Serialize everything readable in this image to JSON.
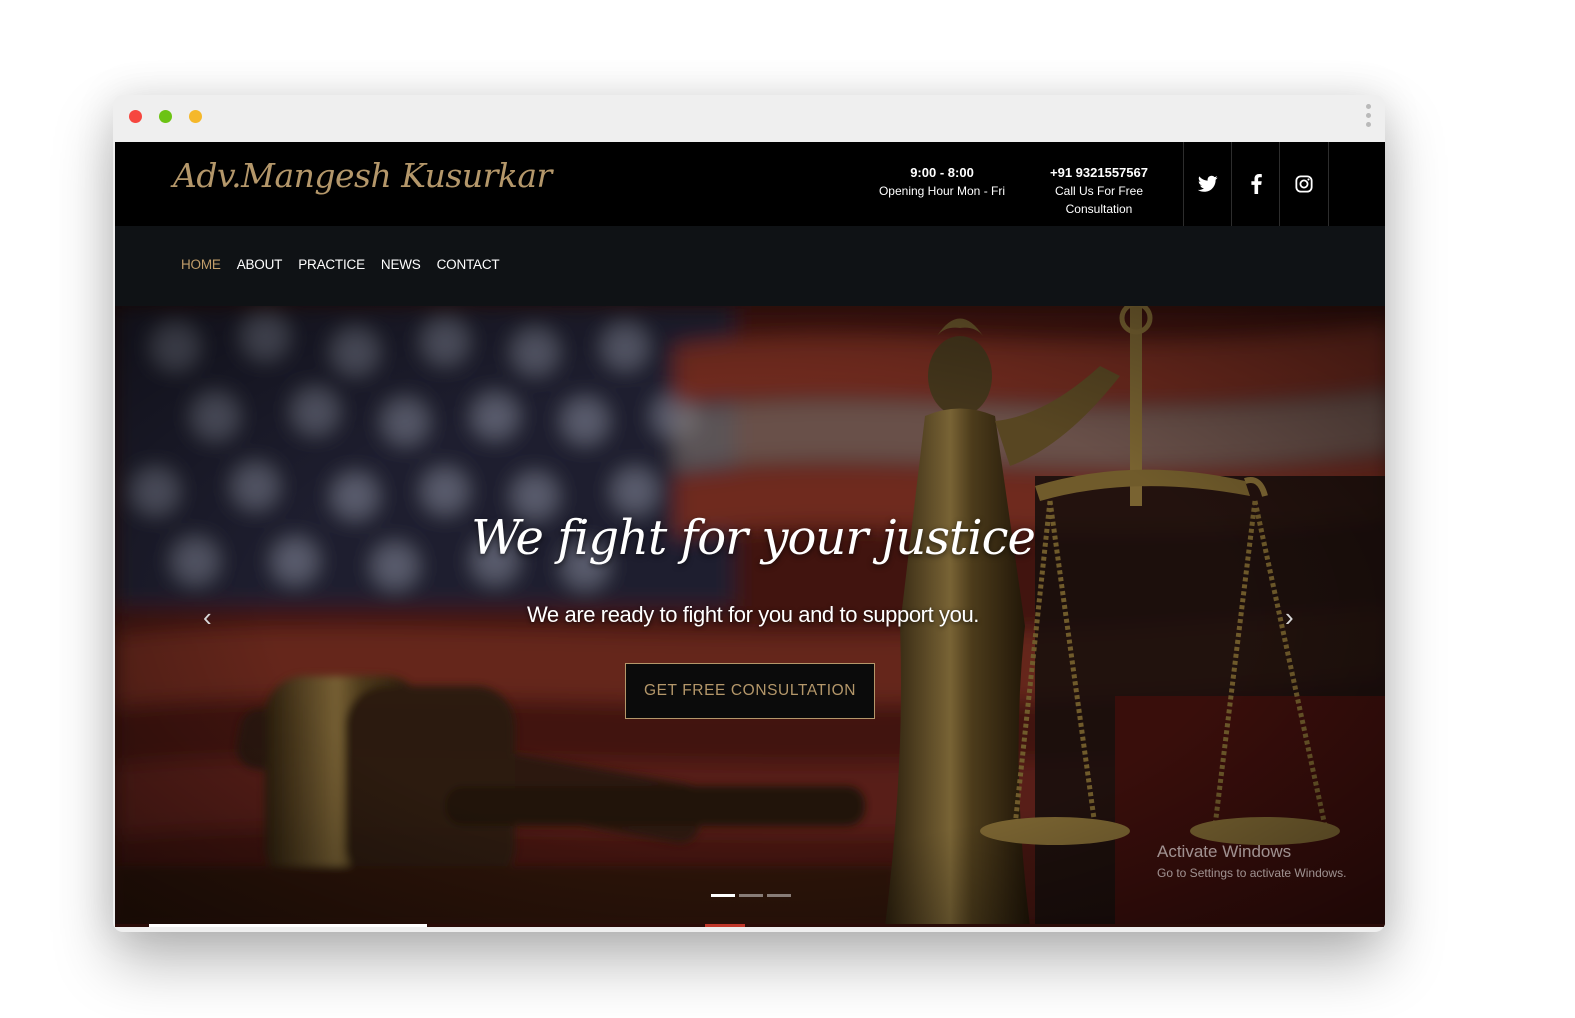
{
  "site": {
    "logo_text": "Adv.Mangesh Kusurkar"
  },
  "header": {
    "hours_time": "9:00 - 8:00",
    "hours_label": "Opening Hour Mon - Fri",
    "phone_number": "+91 9321557567",
    "phone_label": "Call Us For Free Consultation"
  },
  "social": [
    "twitter-icon",
    "facebook-icon",
    "instagram-icon"
  ],
  "nav": {
    "items": [
      {
        "label": "HOME",
        "active": true
      },
      {
        "label": "ABOUT"
      },
      {
        "label": "PRACTICE"
      },
      {
        "label": "NEWS"
      },
      {
        "label": "CONTACT"
      }
    ]
  },
  "hero": {
    "title": "We fight for your justice",
    "subtitle": "We are ready to fight for you and to support you.",
    "cta_label": "GET FREE CONSULTATION",
    "prev_icon": "‹",
    "next_icon": "›",
    "slides_total": 3,
    "active_slide": 1
  },
  "watermark": {
    "line1": "Activate Windows",
    "line2": "Go to Settings to activate Windows."
  },
  "colors": {
    "accent_gold": "#b4976a",
    "nav_active": "#c19d6a",
    "topbar_bg": "#000000",
    "navbar_bg": "#0f1215"
  }
}
